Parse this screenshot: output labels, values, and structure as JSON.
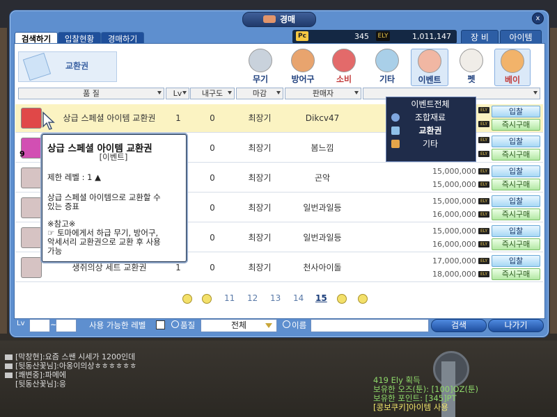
{
  "window": {
    "title": "경매",
    "close_label": "x"
  },
  "tabs": [
    {
      "label": "검색하기",
      "active": true
    },
    {
      "label": "입찰현황",
      "active": false
    },
    {
      "label": "경매하기",
      "active": false
    }
  ],
  "resources": {
    "pc_label": "Pc",
    "pc_value": "345",
    "ely_label": "ELY",
    "ely_value": "1,011,147"
  },
  "right_tabs": [
    {
      "label": "장 비"
    },
    {
      "label": "아이템"
    }
  ],
  "item_selector": {
    "label": "교환권"
  },
  "categories": [
    {
      "label": "무기",
      "color": "#c9d2dc"
    },
    {
      "label": "방어구",
      "color": "#e8a46e"
    },
    {
      "label": "소비",
      "color": "#e36a6a"
    },
    {
      "label": "기타",
      "color": "#a9cfe8"
    },
    {
      "label": "이벤트",
      "color": "#f1b7a3"
    },
    {
      "label": "펫",
      "color": "#f0ede8"
    },
    {
      "label": "베이",
      "color": "#f2b36a"
    }
  ],
  "sort_headers": [
    {
      "label": "품 질"
    },
    {
      "label": "Lv"
    },
    {
      "label": "내구도"
    },
    {
      "label": "마감"
    },
    {
      "label": "판매자"
    },
    {
      "label": ""
    }
  ],
  "dropdown": {
    "items": [
      {
        "label": "이벤트전체"
      },
      {
        "label": "조합재료"
      },
      {
        "label": "교환권"
      },
      {
        "label": "기타"
      }
    ]
  },
  "rows": [
    {
      "name": "상급 스페셜 아이템 교환권",
      "lv": "1",
      "dur": "0",
      "due": "최장기",
      "seller": "Dikcv47",
      "price1": "",
      "price2": "",
      "highlight": true,
      "badge": ""
    },
    {
      "name": "",
      "lv": "",
      "dur": "0",
      "due": "최장기",
      "seller": "봄느낌",
      "price1": "",
      "price2": "",
      "highlight": false,
      "badge": "9"
    },
    {
      "name": "",
      "lv": "",
      "dur": "0",
      "due": "최장기",
      "seller": "곤악",
      "price1": "15,000,000",
      "price2": "15,000,000",
      "highlight": false,
      "badge": ""
    },
    {
      "name": "",
      "lv": "",
      "dur": "0",
      "due": "최장기",
      "seller": "일번과일등",
      "price1": "15,000,000",
      "price2": "16,000,000",
      "highlight": false,
      "badge": ""
    },
    {
      "name": "",
      "lv": "",
      "dur": "0",
      "due": "최장기",
      "seller": "일번과일등",
      "price1": "15,000,000",
      "price2": "16,000,000",
      "highlight": false,
      "badge": ""
    },
    {
      "name": "생쥐의상 세트 교환권",
      "lv": "1",
      "dur": "0",
      "due": "최장기",
      "seller": "천사아이돌",
      "price1": "17,000,000",
      "price2": "18,000,000",
      "highlight": false,
      "badge": ""
    }
  ],
  "buttons": {
    "bid": "입찰",
    "buy_now": "즉시구매",
    "ely_badge": "ELY"
  },
  "pagination": {
    "pages": [
      "11",
      "12",
      "13",
      "14",
      "15"
    ],
    "current": "15"
  },
  "search": {
    "lv_label": "Lv",
    "tilde": "~",
    "usable_level_label": "사용 가능한 레벨",
    "quality_label": "품질",
    "quality_value": "전체",
    "name_label": "이름",
    "search_button": "검색",
    "exit_button": "나가기"
  },
  "tooltip": {
    "title": "상급 스페셜 아이템 교환권",
    "subtitle": "[이벤트]",
    "req_level": "제한 레벨 : 1 ▲",
    "desc1": "상급 스페셜 아이템으로 교환할 수",
    "desc2": "있는 증표",
    "note_head": "※참고※",
    "note1": "☞ 토마에게서 하급 무기, 방어구,",
    "note2": "악세서리 교환권으로 교환 후 사용",
    "note3": "가능"
  },
  "chat": [
    "[막창현]:요즘 스쌘 시세가 1200인데",
    "[뒷동산꽃님]:아옹이의상ㅎㅎㅎㅎㅎㅎ",
    "[쾌변중]:파메에",
    "[뒷동산꽃님]:응"
  ],
  "system_messages": [
    {
      "text": "419 Ely 획득",
      "color": "green"
    },
    {
      "text": "보유한 오즈(툰): [100]OZ(툰)",
      "color": "green"
    },
    {
      "text": "보유한 포인트: [345]PT",
      "color": "green"
    },
    {
      "text": "[콩보쿠키]아이템 사용",
      "color": "yellow"
    }
  ]
}
